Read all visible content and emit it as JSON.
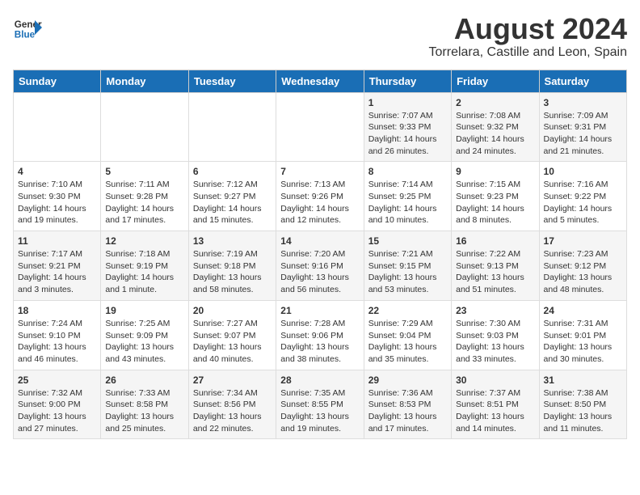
{
  "header": {
    "logo_general": "General",
    "logo_blue": "Blue",
    "title": "August 2024",
    "subtitle": "Torrelara, Castille and Leon, Spain"
  },
  "days_of_week": [
    "Sunday",
    "Monday",
    "Tuesday",
    "Wednesday",
    "Thursday",
    "Friday",
    "Saturday"
  ],
  "weeks": [
    [
      {
        "day": "",
        "data": ""
      },
      {
        "day": "",
        "data": ""
      },
      {
        "day": "",
        "data": ""
      },
      {
        "day": "",
        "data": ""
      },
      {
        "day": "1",
        "data": "Sunrise: 7:07 AM\nSunset: 9:33 PM\nDaylight: 14 hours and 26 minutes."
      },
      {
        "day": "2",
        "data": "Sunrise: 7:08 AM\nSunset: 9:32 PM\nDaylight: 14 hours and 24 minutes."
      },
      {
        "day": "3",
        "data": "Sunrise: 7:09 AM\nSunset: 9:31 PM\nDaylight: 14 hours and 21 minutes."
      }
    ],
    [
      {
        "day": "4",
        "data": "Sunrise: 7:10 AM\nSunset: 9:30 PM\nDaylight: 14 hours and 19 minutes."
      },
      {
        "day": "5",
        "data": "Sunrise: 7:11 AM\nSunset: 9:28 PM\nDaylight: 14 hours and 17 minutes."
      },
      {
        "day": "6",
        "data": "Sunrise: 7:12 AM\nSunset: 9:27 PM\nDaylight: 14 hours and 15 minutes."
      },
      {
        "day": "7",
        "data": "Sunrise: 7:13 AM\nSunset: 9:26 PM\nDaylight: 14 hours and 12 minutes."
      },
      {
        "day": "8",
        "data": "Sunrise: 7:14 AM\nSunset: 9:25 PM\nDaylight: 14 hours and 10 minutes."
      },
      {
        "day": "9",
        "data": "Sunrise: 7:15 AM\nSunset: 9:23 PM\nDaylight: 14 hours and 8 minutes."
      },
      {
        "day": "10",
        "data": "Sunrise: 7:16 AM\nSunset: 9:22 PM\nDaylight: 14 hours and 5 minutes."
      }
    ],
    [
      {
        "day": "11",
        "data": "Sunrise: 7:17 AM\nSunset: 9:21 PM\nDaylight: 14 hours and 3 minutes."
      },
      {
        "day": "12",
        "data": "Sunrise: 7:18 AM\nSunset: 9:19 PM\nDaylight: 14 hours and 1 minute."
      },
      {
        "day": "13",
        "data": "Sunrise: 7:19 AM\nSunset: 9:18 PM\nDaylight: 13 hours and 58 minutes."
      },
      {
        "day": "14",
        "data": "Sunrise: 7:20 AM\nSunset: 9:16 PM\nDaylight: 13 hours and 56 minutes."
      },
      {
        "day": "15",
        "data": "Sunrise: 7:21 AM\nSunset: 9:15 PM\nDaylight: 13 hours and 53 minutes."
      },
      {
        "day": "16",
        "data": "Sunrise: 7:22 AM\nSunset: 9:13 PM\nDaylight: 13 hours and 51 minutes."
      },
      {
        "day": "17",
        "data": "Sunrise: 7:23 AM\nSunset: 9:12 PM\nDaylight: 13 hours and 48 minutes."
      }
    ],
    [
      {
        "day": "18",
        "data": "Sunrise: 7:24 AM\nSunset: 9:10 PM\nDaylight: 13 hours and 46 minutes."
      },
      {
        "day": "19",
        "data": "Sunrise: 7:25 AM\nSunset: 9:09 PM\nDaylight: 13 hours and 43 minutes."
      },
      {
        "day": "20",
        "data": "Sunrise: 7:27 AM\nSunset: 9:07 PM\nDaylight: 13 hours and 40 minutes."
      },
      {
        "day": "21",
        "data": "Sunrise: 7:28 AM\nSunset: 9:06 PM\nDaylight: 13 hours and 38 minutes."
      },
      {
        "day": "22",
        "data": "Sunrise: 7:29 AM\nSunset: 9:04 PM\nDaylight: 13 hours and 35 minutes."
      },
      {
        "day": "23",
        "data": "Sunrise: 7:30 AM\nSunset: 9:03 PM\nDaylight: 13 hours and 33 minutes."
      },
      {
        "day": "24",
        "data": "Sunrise: 7:31 AM\nSunset: 9:01 PM\nDaylight: 13 hours and 30 minutes."
      }
    ],
    [
      {
        "day": "25",
        "data": "Sunrise: 7:32 AM\nSunset: 9:00 PM\nDaylight: 13 hours and 27 minutes."
      },
      {
        "day": "26",
        "data": "Sunrise: 7:33 AM\nSunset: 8:58 PM\nDaylight: 13 hours and 25 minutes."
      },
      {
        "day": "27",
        "data": "Sunrise: 7:34 AM\nSunset: 8:56 PM\nDaylight: 13 hours and 22 minutes."
      },
      {
        "day": "28",
        "data": "Sunrise: 7:35 AM\nSunset: 8:55 PM\nDaylight: 13 hours and 19 minutes."
      },
      {
        "day": "29",
        "data": "Sunrise: 7:36 AM\nSunset: 8:53 PM\nDaylight: 13 hours and 17 minutes."
      },
      {
        "day": "30",
        "data": "Sunrise: 7:37 AM\nSunset: 8:51 PM\nDaylight: 13 hours and 14 minutes."
      },
      {
        "day": "31",
        "data": "Sunrise: 7:38 AM\nSunset: 8:50 PM\nDaylight: 13 hours and 11 minutes."
      }
    ]
  ]
}
